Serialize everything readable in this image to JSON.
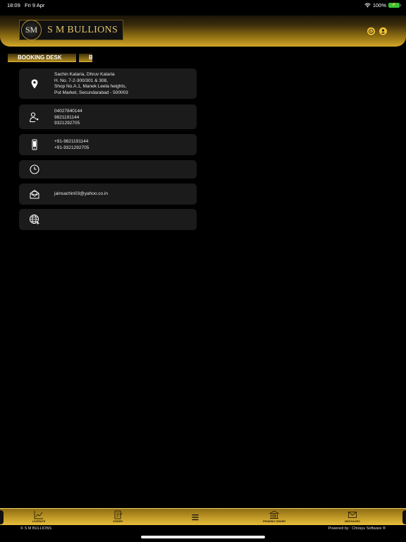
{
  "status_bar": {
    "time": "18:09",
    "date": "Fri 9 Apr",
    "battery_percent": "100%",
    "icons": [
      "wifi-icon",
      "battery-icon"
    ]
  },
  "header": {
    "logo_text": "SM",
    "brand_name": "S M BULLIONS",
    "right_icons": [
      "whatsapp-icon",
      "user-icon"
    ],
    "accent_color": "#d3a728"
  },
  "tabs": [
    {
      "label": "BOOKING DESK"
    },
    {
      "label": "B"
    }
  ],
  "contact": {
    "address": [
      "Sachin Kataria, Dhruv Kataria",
      "H. No. 7-2-300/301 & 308,",
      "Shop No.A.1, Manek Leela heights,",
      "Pot Market, Secundarabad - 500003"
    ],
    "phones": [
      "04027840144",
      "9821191144",
      "9321292705"
    ],
    "mobiles": [
      "+91-9821191144",
      "+91-9321292705"
    ],
    "hours": "",
    "email": "jainsachin03@yahoo.co.in",
    "website": ""
  },
  "bottom_nav": {
    "items": [
      {
        "label": "LIVERATE",
        "icon": "chart-icon"
      },
      {
        "label": "ORDER",
        "icon": "order-icon"
      },
      {
        "label": "",
        "icon": "menu-icon"
      },
      {
        "label": "PENDING ORDER",
        "icon": "bank-icon"
      },
      {
        "label": "MESSAGES",
        "icon": "envelope-icon"
      }
    ]
  },
  "footer": {
    "copyright": "© S M BULLIONS",
    "powered_by": "Powered by : Chirayu Software ®"
  }
}
